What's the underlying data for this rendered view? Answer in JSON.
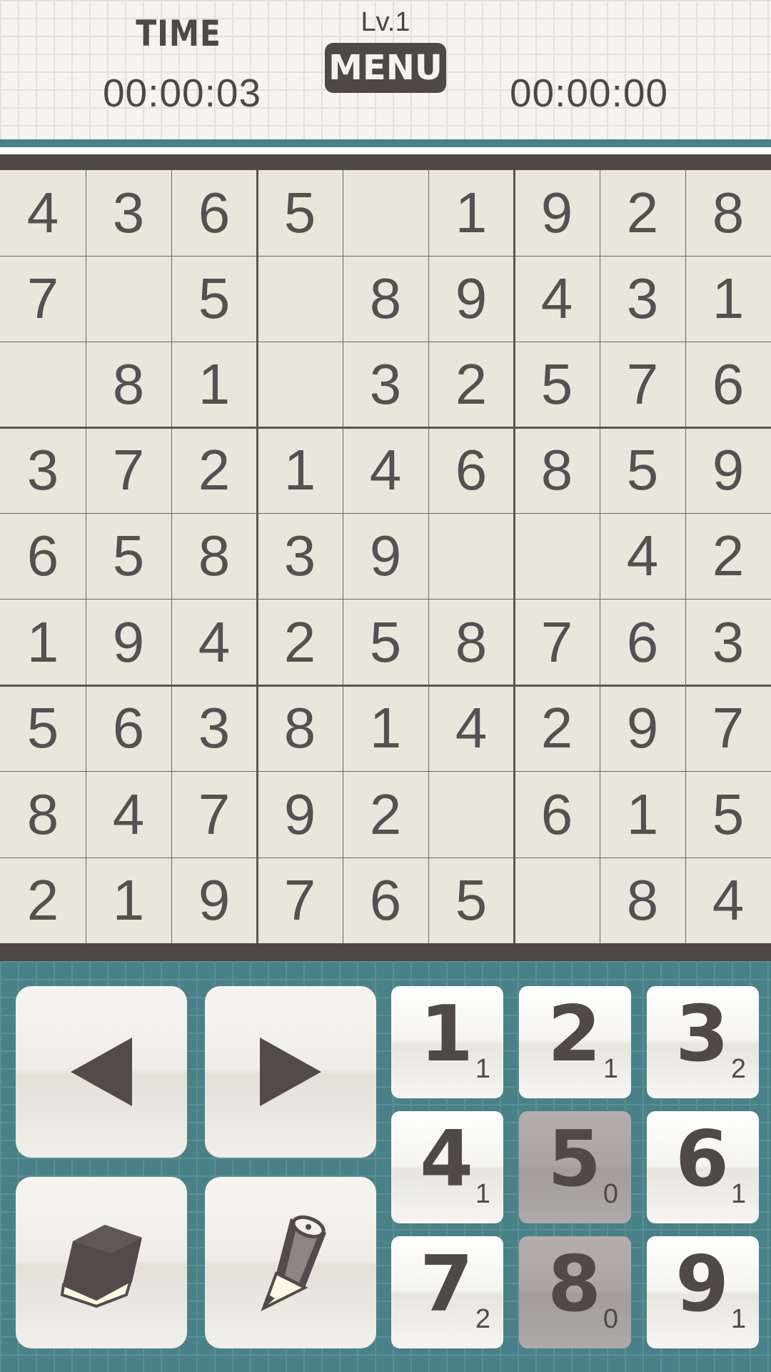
{
  "header": {
    "time_label": "TIME",
    "level": "Lv.1",
    "menu_label": "MENU",
    "timer_elapsed": "00:00:03",
    "timer_best": "00:00:00"
  },
  "board": {
    "cells": [
      [
        "4",
        "3",
        "6",
        "5",
        "",
        "1",
        "9",
        "2",
        "8"
      ],
      [
        "7",
        "",
        "5",
        "",
        "8",
        "9",
        "4",
        "3",
        "1"
      ],
      [
        "",
        "8",
        "1",
        "",
        "3",
        "2",
        "5",
        "7",
        "6"
      ],
      [
        "3",
        "7",
        "2",
        "1",
        "4",
        "6",
        "8",
        "5",
        "9"
      ],
      [
        "6",
        "5",
        "8",
        "3",
        "9",
        "",
        "",
        "4",
        "2"
      ],
      [
        "1",
        "9",
        "4",
        "2",
        "5",
        "8",
        "7",
        "6",
        "3"
      ],
      [
        "5",
        "6",
        "3",
        "8",
        "1",
        "4",
        "2",
        "9",
        "7"
      ],
      [
        "8",
        "4",
        "7",
        "9",
        "2",
        "",
        "6",
        "1",
        "5"
      ],
      [
        "2",
        "1",
        "9",
        "7",
        "6",
        "5",
        "",
        "8",
        "4"
      ]
    ]
  },
  "controls": {
    "prev_icon": "left-triangle-icon",
    "next_icon": "right-triangle-icon",
    "eraser_icon": "eraser-icon",
    "pencil_icon": "pencil-icon",
    "numbers": [
      {
        "digit": "1",
        "count": "1",
        "used": false
      },
      {
        "digit": "2",
        "count": "1",
        "used": false
      },
      {
        "digit": "3",
        "count": "2",
        "used": false
      },
      {
        "digit": "4",
        "count": "1",
        "used": false
      },
      {
        "digit": "5",
        "count": "0",
        "used": true
      },
      {
        "digit": "6",
        "count": "1",
        "used": false
      },
      {
        "digit": "7",
        "count": "2",
        "used": false
      },
      {
        "digit": "8",
        "count": "0",
        "used": true
      },
      {
        "digit": "9",
        "count": "1",
        "used": false
      }
    ]
  },
  "colors": {
    "teal": "#4a8189",
    "dark": "#4e4847",
    "board_bg": "#e9e7dc"
  }
}
